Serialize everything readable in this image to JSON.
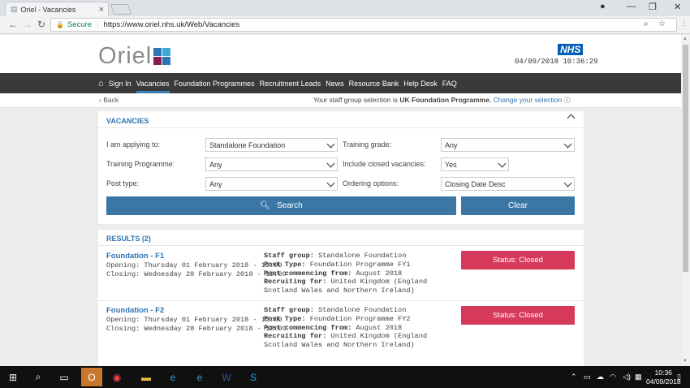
{
  "browser": {
    "tab_title": "Oriel - Vacancies",
    "tab_close": "×",
    "secure_label": "Secure",
    "url": "https://www.oriel.nhs.uk/Web/Vacancies"
  },
  "header": {
    "logo_text": "Oriel",
    "logo_colors": [
      "#2f74b3",
      "#3fa9d6",
      "#8b1c4f",
      "#2f74b3"
    ],
    "nhs_badge": "NHS",
    "datetime": "04/09/2018 10:36:29"
  },
  "nav": {
    "items": [
      "Sign In",
      "Vacancies",
      "Foundation Programmes",
      "Recruitment Leads",
      "News",
      "Resource Bank",
      "Help Desk",
      "FAQ"
    ],
    "active": "Vacancies"
  },
  "subbar": {
    "back": "Back",
    "staff_prefix": "Your staff group selection is ",
    "staff_group": "UK Foundation Programme.",
    "change_link": "Change your selection"
  },
  "vacancies": {
    "title": "VACANCIES",
    "applying_label": "I am applying to:",
    "applying_value": "Standalone Foundation",
    "grade_label": "Training grade:",
    "grade_value": "Any",
    "programme_label": "Training Programme:",
    "programme_value": "Any",
    "closed_label": "Include closed vacancies:",
    "closed_value": "Yes",
    "post_label": "Post type:",
    "post_value": "Any",
    "ordering_label": "Ordering options:",
    "ordering_value": "Closing Date Desc",
    "search_label": "Search",
    "clear_label": "Clear"
  },
  "results": {
    "title": "RESULTS (2)",
    "items": [
      {
        "title": "Foundation - F1",
        "opening": "Opening: Thursday 01 February 2018 - 12:00",
        "closing": "Closing: Wednesday 28 February 2018 - 12:00",
        "staff_group_label": "Staff group:",
        "staff_group": "Standalone Foundation",
        "post_type_label": "Post Type:",
        "post_type": "Foundation Programme FY1",
        "commencing_label": "Post commencing from:",
        "commencing": "August 2018",
        "recruiting_label": "Recruiting for:",
        "recruiting": "United Kingdom (England Scotland Wales and Northern Ireland)",
        "status": "Status: Closed"
      },
      {
        "title": "Foundation - F2",
        "opening": "Opening: Thursday 01 February 2018 - 12:00",
        "closing": "Closing: Wednesday 28 February 2018 - 12:00",
        "staff_group_label": "Staff group:",
        "staff_group": "Standalone Foundation",
        "post_type_label": "Post Type:",
        "post_type": "Foundation Programme FY2",
        "commencing_label": "Post commencing from:",
        "commencing": "August 2018",
        "recruiting_label": "Recruiting for:",
        "recruiting": "United Kingdom (England Scotland Wales and Northern Ireland)",
        "status": "Status: Closed"
      }
    ]
  },
  "taskbar": {
    "time": "10:36",
    "date": "04/09/2018"
  }
}
